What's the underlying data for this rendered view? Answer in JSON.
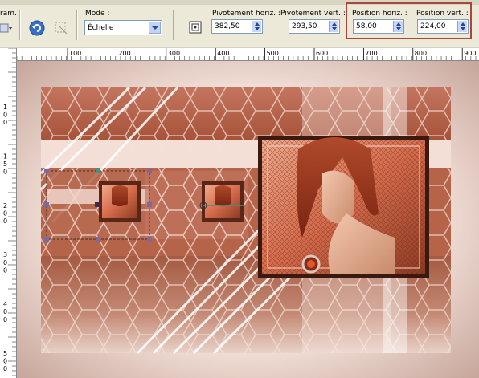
{
  "toolbar": {
    "param_label": "ram. :",
    "mode_label": "Mode :",
    "mode_value": "Échelle",
    "pivot_h_label": "Pivotement horiz. :",
    "pivot_h_value": "382,50",
    "pivot_v_label": "Pivotement vert. :",
    "pivot_v_value": "293,50",
    "pos_h_label": "Position horiz. :",
    "pos_h_value": "58,00",
    "pos_v_label": "Position vert. :",
    "pos_v_value": "224,00",
    "highlight_color": "#a8473a"
  },
  "ruler": {
    "h_labels": [
      "100",
      "200",
      "300",
      "400",
      "500",
      "600",
      "700",
      "800",
      "900"
    ],
    "v_labels": [
      "1",
      "0",
      "0",
      "1",
      "5",
      "0",
      "2",
      "0",
      "0",
      "3",
      "0",
      "0",
      "4",
      "0",
      "0",
      "5",
      "0",
      "0"
    ]
  },
  "colors": {
    "brand": "#a8473a",
    "canvas_bg": "#f5e9e4",
    "rust": "#9b4a33"
  }
}
